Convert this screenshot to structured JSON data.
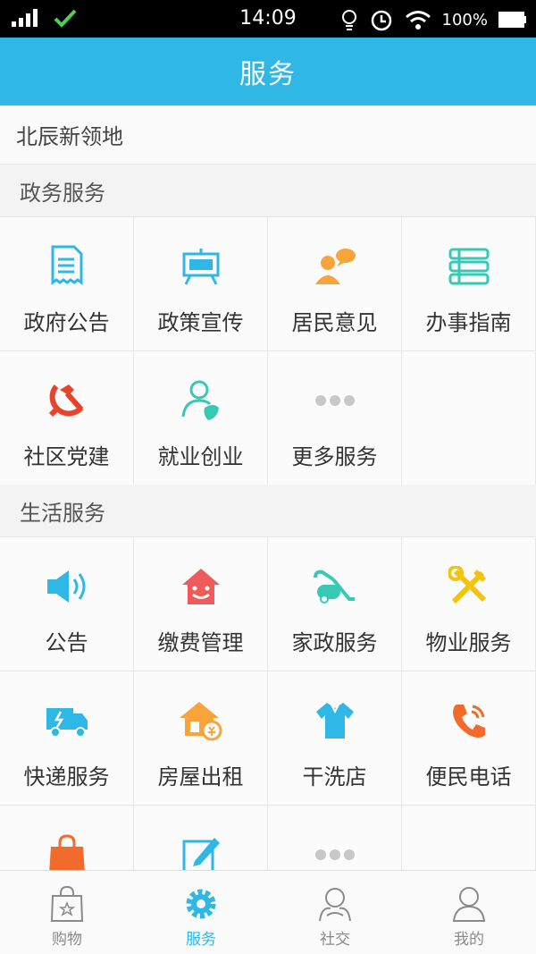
{
  "status_bar": {
    "time": "14:09",
    "battery": "100%"
  },
  "header": {
    "title": "服务"
  },
  "community": {
    "name": "北辰新领地"
  },
  "sections": [
    {
      "title": "政务服务",
      "items": [
        {
          "label": "政府公告",
          "icon": "document-icon"
        },
        {
          "label": "政策宣传",
          "icon": "billboard-icon"
        },
        {
          "label": "居民意见",
          "icon": "feedback-person-icon"
        },
        {
          "label": "办事指南",
          "icon": "books-icon"
        },
        {
          "label": "社区党建",
          "icon": "hammer-sickle-icon"
        },
        {
          "label": "就业创业",
          "icon": "person-leaf-icon"
        },
        {
          "label": "更多服务",
          "icon": "more-dots-icon"
        }
      ]
    },
    {
      "title": "生活服务",
      "items": [
        {
          "label": "公告",
          "icon": "speaker-icon"
        },
        {
          "label": "缴费管理",
          "icon": "smiling-house-icon"
        },
        {
          "label": "家政服务",
          "icon": "vacuum-cleaner-icon"
        },
        {
          "label": "物业服务",
          "icon": "tools-icon"
        },
        {
          "label": "快递服务",
          "icon": "delivery-truck-icon"
        },
        {
          "label": "房屋出租",
          "icon": "house-coin-icon"
        },
        {
          "label": "干洗店",
          "icon": "shirt-icon"
        },
        {
          "label": "便民电话",
          "icon": "phone-icon"
        },
        {
          "label": "",
          "icon": "shopping-bag-icon"
        },
        {
          "label": "",
          "icon": "edit-note-icon"
        },
        {
          "label": "",
          "icon": "more-dots-icon"
        }
      ]
    }
  ],
  "tabs": [
    {
      "label": "购物",
      "icon": "shopping-bag-outline-icon"
    },
    {
      "label": "服务",
      "icon": "gear-icon",
      "active": true
    },
    {
      "label": "社交",
      "icon": "social-people-icon"
    },
    {
      "label": "我的",
      "icon": "user-profile-icon"
    }
  ],
  "colors": {
    "brand": "#2fb7e6",
    "party_red": "#e8432c",
    "orange": "#f8a43a",
    "teal": "#36c9b4"
  }
}
